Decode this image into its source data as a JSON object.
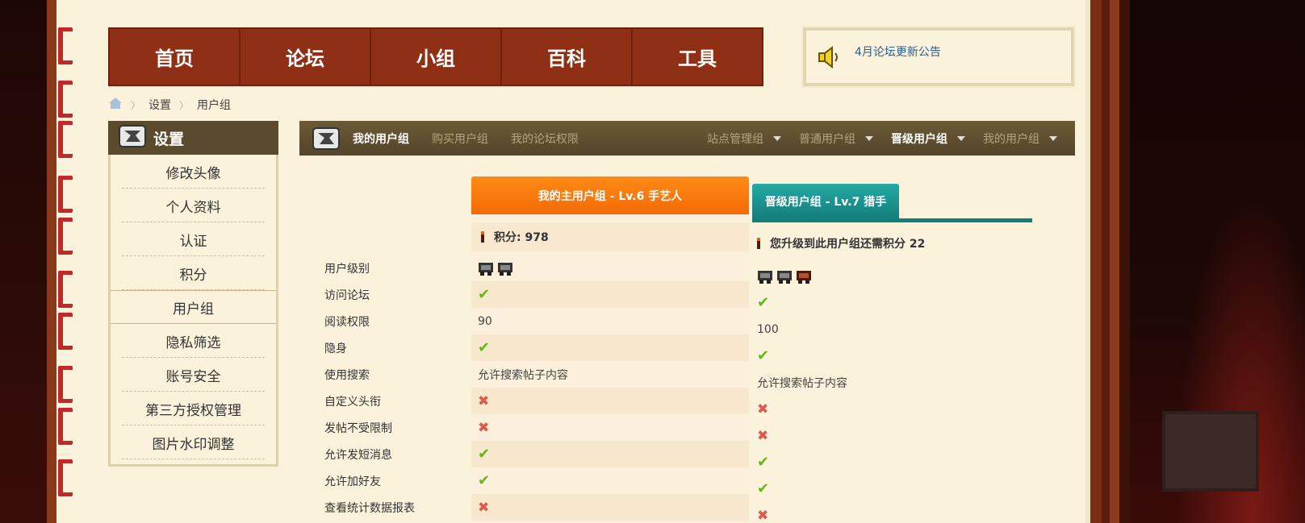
{
  "topnav": {
    "items": [
      "首页",
      "论坛",
      "小组",
      "百科",
      "工具"
    ]
  },
  "notice": {
    "text": "4月论坛更新公告"
  },
  "breadcrumb": {
    "items": [
      "设置",
      "用户组"
    ]
  },
  "sidebar": {
    "title": "设置",
    "items": [
      "修改头像",
      "个人资料",
      "认证",
      "积分",
      "用户组",
      "隐私筛选",
      "账号安全",
      "第三方授权管理",
      "图片水印调整"
    ],
    "active": "用户组"
  },
  "subnav": {
    "tabs": [
      "我的用户组",
      "购买用户组",
      "我的论坛权限"
    ],
    "dropdowns": [
      "站点管理组",
      "普通用户组",
      "晋级用户组",
      "我的用户组"
    ]
  },
  "comparison": {
    "current_header": "我的主用户组 - Lv.6 手艺人",
    "next_header": "晋级用户组 - Lv.7 猎手",
    "current_score": "积分: 978",
    "next_score": "您升级到此用户组还需积分 22",
    "labels": [
      "用户级别",
      "访问论坛",
      "阅读权限",
      "隐身",
      "使用搜索",
      "自定义头衔",
      "发帖不受限制",
      "允许发短消息",
      "允许加好友",
      "查看统计数据报表"
    ],
    "current_values": {
      "level_icons": 2,
      "read_permission": "90",
      "search": "允许搜索帖子内容"
    },
    "next_values": {
      "level_icons": 3,
      "read_permission": "100",
      "search": "允许搜索帖子内容"
    },
    "check_color": "#6ab51e",
    "cross_color": "#e0574a"
  },
  "colors": {
    "nav_bg": "#8f2f15",
    "current_header": "#f46a05",
    "next_header": "#137f7c",
    "page_bg": "#fbf2dc"
  }
}
